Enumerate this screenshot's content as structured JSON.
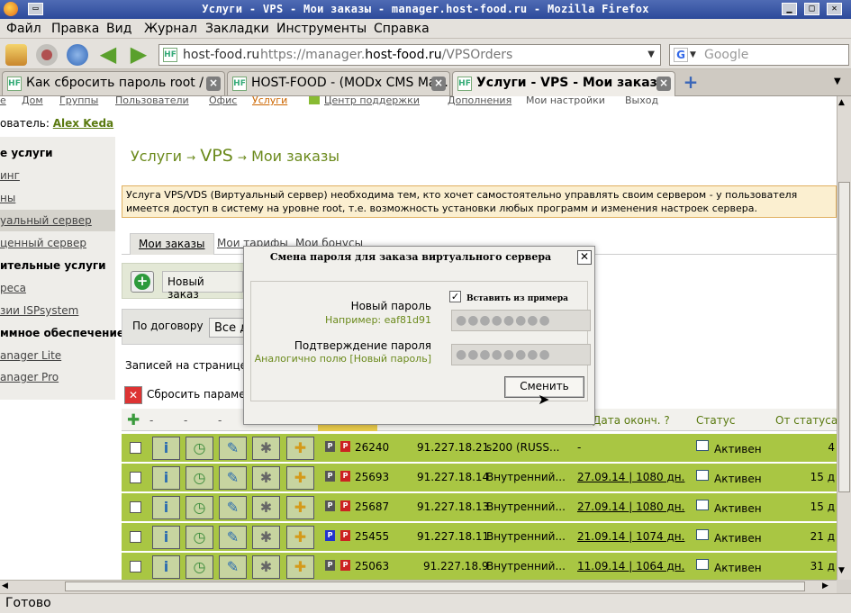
{
  "window": {
    "title": "Услуги - VPS - Мои заказы - manager.host-food.ru - Mozilla Firefox"
  },
  "menu": [
    "Файл",
    "Правка",
    "Вид",
    "Журнал",
    "Закладки",
    "Инструменты",
    "Справка"
  ],
  "urlbar": {
    "site": "host-food.ru",
    "url_prefix": "https://manager.",
    "url_host": "host-food.ru",
    "url_path": "/VPSOrders"
  },
  "search": {
    "placeholder": "Google"
  },
  "tabs": [
    {
      "label": "Как сбросить пароль root / ..."
    },
    {
      "label": "HOST-FOOD - (MODx CMS Ma..."
    },
    {
      "label": "Услуги - VPS - Мои заказ..."
    }
  ],
  "topnav": [
    "е",
    "Дом",
    "Группы",
    "Пользователи",
    "Офис",
    "Услуги",
    "Центр поддержки",
    "Дополнения",
    "Мои настройки",
    "Выход"
  ],
  "user": {
    "prefix": "ователь:",
    "name": "Alex Keda"
  },
  "sidebar": [
    "е услуги",
    "инг",
    "ны",
    "уальный сервер",
    "ценный сервер",
    "ительные услуги",
    "реса",
    "зии ISPsystem",
    "ммное обеспечение",
    "anager Lite",
    "anager Pro"
  ],
  "page": {
    "crumb1": "Услуги",
    "arrow": "→",
    "crumb2": "VPS",
    "crumb3": "Мои заказы",
    "info": "Услуга VPS/VDS (Виртуальный сервер) необходима тем, кто хочет самостоятельно управлять своим сервером - у пользователя имеется доступ в систему на уровне root, т.е. возможность установки любых программ и изменения настроек сервера.",
    "subtabs": [
      "Мои заказы",
      "Мои тарифы",
      "Мои бонусы"
    ],
    "new_order": "Новый заказ",
    "by_contract": "По договору",
    "all": "Все д",
    "per_page": "Записей на странице:",
    "reset": "Сбросить парамет"
  },
  "table": {
    "headers": {
      "expires": "Дата оконч. ?",
      "status": "Статус",
      "from_status": "От статуса"
    },
    "rows": [
      {
        "id": "26240",
        "ip": "91.227.18.21",
        "name": "s200 (RUSS...",
        "expires": "-",
        "status": "Активен",
        "days": "4"
      },
      {
        "id": "25693",
        "ip": "91.227.18.14",
        "name": "Внутренний...",
        "expires": "27.09.14 | 1080 дн.",
        "status": "Активен",
        "days": "15 д"
      },
      {
        "id": "25687",
        "ip": "91.227.18.13",
        "name": "Внутренний...",
        "expires": "27.09.14 | 1080 дн.",
        "status": "Активен",
        "days": "15 д"
      },
      {
        "id": "25455",
        "ip": "91.227.18.11",
        "name": "Внутренний...",
        "expires": "21.09.14 | 1074 дн.",
        "status": "Активен",
        "days": "21 д"
      },
      {
        "id": "25063",
        "ip": "91.227.18.9",
        "name": "Внутренний...",
        "expires": "11.09.14 | 1064 дн.",
        "status": "Активен",
        "days": "31 д"
      }
    ]
  },
  "modal": {
    "title": "Смена пароля для заказа виртуального сервера",
    "new_pw": "Новый пароль",
    "example": "Например: eaf81d91",
    "insert": "Вставить из примера",
    "confirm": "Подтверждение пароля",
    "same": "Аналогично полю [Новый пароль]",
    "mask": "●●●●●●●●",
    "button": "Сменить"
  },
  "status": "Готово"
}
